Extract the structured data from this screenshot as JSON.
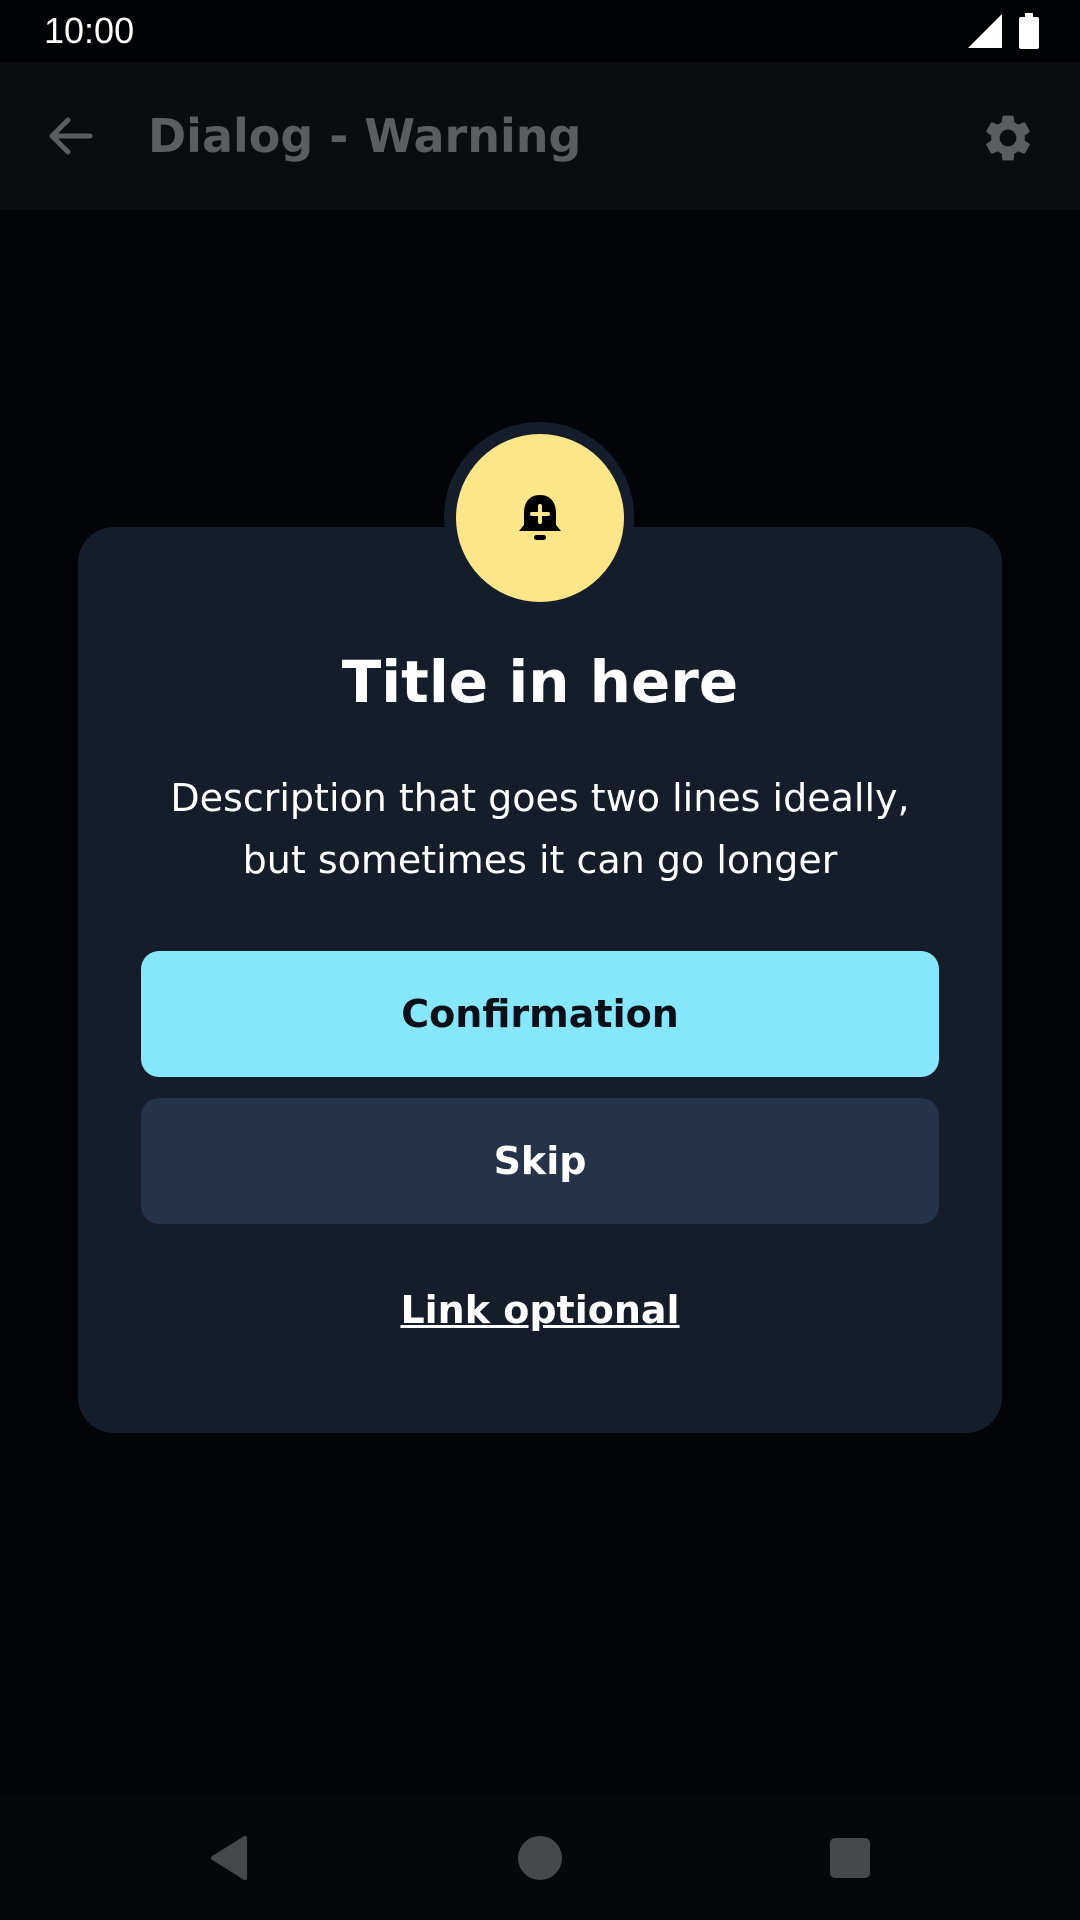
{
  "status_bar": {
    "time": "10:00",
    "icons": [
      "cellular-signal-icon",
      "battery-icon"
    ]
  },
  "app_bar": {
    "title": "Dialog - Warning",
    "back_icon": "arrow-left-icon",
    "settings_icon": "gear-icon"
  },
  "dialog": {
    "icon": "bell-plus-icon",
    "title": "Title in here",
    "description": "Description that goes two lines ideally, but sometimes it can go longer",
    "primary_button": "Confirmation",
    "secondary_button": "Skip",
    "link": "Link optional"
  },
  "nav_bar": {
    "back_icon": "nav-back-triangle-icon",
    "home_icon": "nav-home-circle-icon",
    "recents_icon": "nav-recents-square-icon"
  },
  "colors": {
    "background": "#020408",
    "dialog": "#151d2b",
    "primary": "#85e6fc",
    "secondary": "#24324a",
    "warning_badge": "#fde58a"
  }
}
